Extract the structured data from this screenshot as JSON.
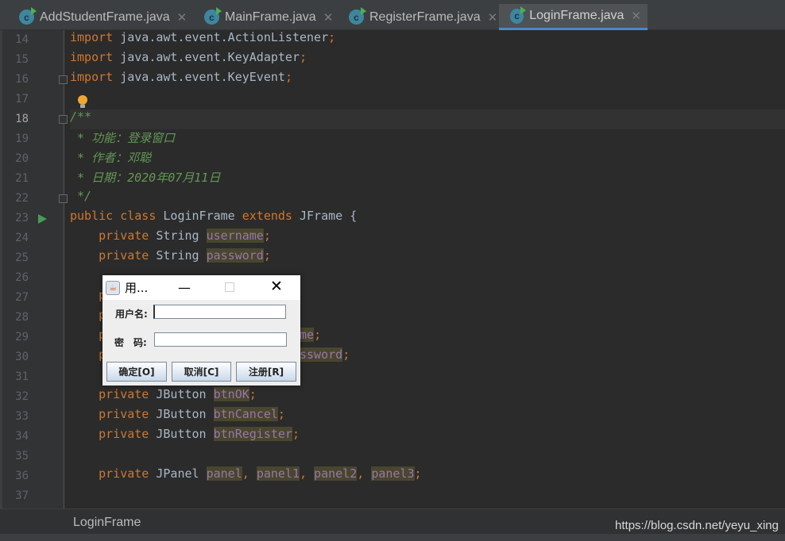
{
  "tabs": [
    {
      "label": "AddStudentFrame.java",
      "active": false
    },
    {
      "label": "MainFrame.java",
      "active": false
    },
    {
      "label": "RegisterFrame.java",
      "active": false
    },
    {
      "label": "LoginFrame.java",
      "active": true
    }
  ],
  "current_line": 18,
  "lines": [
    {
      "n": "14",
      "seg": [
        [
          "kw",
          "import "
        ],
        [
          "id",
          "java.awt.event.ActionListener"
        ],
        [
          "pu",
          ";"
        ]
      ]
    },
    {
      "n": "15",
      "seg": [
        [
          "kw",
          "import "
        ],
        [
          "id",
          "java.awt.event.KeyAdapter"
        ],
        [
          "pu",
          ";"
        ]
      ]
    },
    {
      "n": "16",
      "seg": [
        [
          "kw",
          "import "
        ],
        [
          "id",
          "java.awt.event.KeyEvent"
        ],
        [
          "pu",
          ";"
        ]
      ]
    },
    {
      "n": "17",
      "seg": []
    },
    {
      "n": "18",
      "seg": [
        [
          "cm",
          "/**"
        ]
      ]
    },
    {
      "n": "19",
      "seg": [
        [
          "cm",
          " * 功能：登录窗口"
        ]
      ]
    },
    {
      "n": "20",
      "seg": [
        [
          "cm",
          " * 作者：邓聪"
        ]
      ]
    },
    {
      "n": "21",
      "seg": [
        [
          "cm",
          " * 日期：2020年07月11日"
        ]
      ]
    },
    {
      "n": "22",
      "seg": [
        [
          "cm",
          " */"
        ]
      ]
    },
    {
      "n": "23",
      "seg": [
        [
          "kw",
          "public class "
        ],
        [
          "id",
          "LoginFrame "
        ],
        [
          "kw",
          "extends "
        ],
        [
          "id",
          "JFrame {"
        ]
      ]
    },
    {
      "n": "24",
      "seg": [
        [
          "kw",
          "    private "
        ],
        [
          "id",
          "String "
        ],
        [
          "fd",
          "username"
        ],
        [
          "pu",
          ";"
        ]
      ]
    },
    {
      "n": "25",
      "seg": [
        [
          "kw",
          "    private "
        ],
        [
          "id",
          "String "
        ],
        [
          "fd",
          "password"
        ],
        [
          "pu",
          ";"
        ]
      ]
    },
    {
      "n": "26",
      "seg": []
    },
    {
      "n": "27",
      "seg": [
        [
          "kw",
          "    p"
        ]
      ]
    },
    {
      "n": "28",
      "seg": [
        [
          "kw",
          "    p"
        ]
      ]
    },
    {
      "n": "29",
      "seg": [
        [
          "kw",
          "    p"
        ],
        [
          "id",
          "                           "
        ],
        [
          "fd",
          "me"
        ],
        [
          "pu",
          ";"
        ]
      ]
    },
    {
      "n": "30",
      "seg": [
        [
          "kw",
          "    p"
        ],
        [
          "id",
          "                           "
        ],
        [
          "fd",
          "ssword"
        ],
        [
          "pu",
          ";"
        ]
      ]
    },
    {
      "n": "31",
      "seg": []
    },
    {
      "n": "32",
      "seg": [
        [
          "kw",
          "    private "
        ],
        [
          "id",
          "JButton "
        ],
        [
          "fd",
          "btnOK"
        ],
        [
          "pu",
          ";"
        ]
      ]
    },
    {
      "n": "33",
      "seg": [
        [
          "kw",
          "    private "
        ],
        [
          "id",
          "JButton "
        ],
        [
          "fd",
          "btnCancel"
        ],
        [
          "pu",
          ";"
        ]
      ]
    },
    {
      "n": "34",
      "seg": [
        [
          "kw",
          "    private "
        ],
        [
          "id",
          "JButton "
        ],
        [
          "fd",
          "btnRegister"
        ],
        [
          "pu",
          ";"
        ]
      ]
    },
    {
      "n": "35",
      "seg": []
    },
    {
      "n": "36",
      "seg": [
        [
          "kw",
          "    private "
        ],
        [
          "id",
          "JPanel "
        ],
        [
          "fd",
          "panel"
        ],
        [
          "pu",
          ", "
        ],
        [
          "fd",
          "panel1"
        ],
        [
          "pu",
          ", "
        ],
        [
          "fd",
          "panel2"
        ],
        [
          "pu",
          ", "
        ],
        [
          "fd",
          "panel3"
        ],
        [
          "pu",
          ";"
        ]
      ]
    },
    {
      "n": "37",
      "seg": []
    }
  ],
  "breadcrumb": "LoginFrame",
  "watermark": "https://blog.csdn.net/yeyu_xing",
  "dialog": {
    "title": "用...",
    "username_label": "用户名:",
    "password_label": "密　码:",
    "username_value": "",
    "password_value": "",
    "ok": "确定[O]",
    "cancel": "取消[C]",
    "register": "注册[R]"
  },
  "colors": {
    "keyword": "#cc7832",
    "comment": "#629755",
    "field": "#9876aa",
    "background": "#2b2b2b"
  }
}
